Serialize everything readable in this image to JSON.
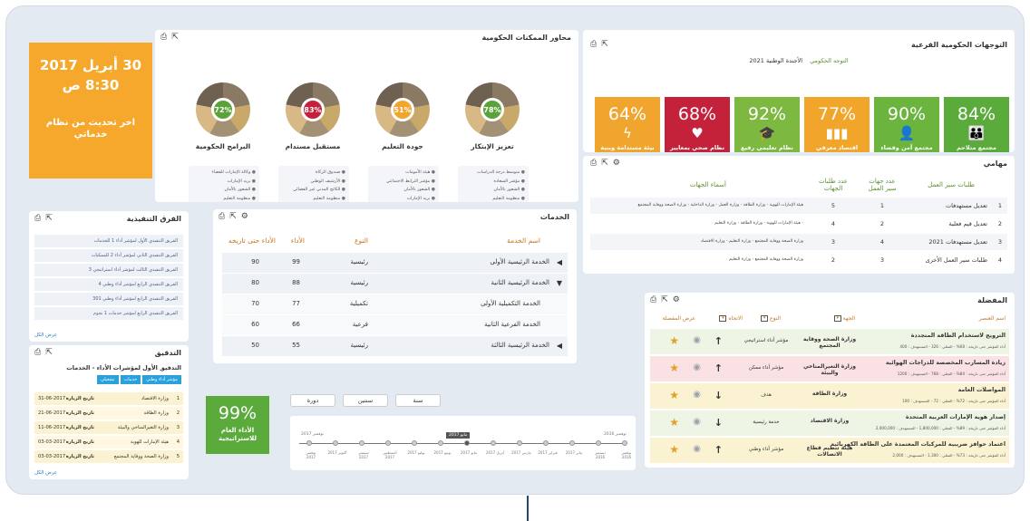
{
  "header_clock": {
    "date": "30 أبريل 2017",
    "time": "8:30 ص",
    "note": "اخر تحديث من نظام خدماتي"
  },
  "sub_directions": {
    "title": "التوجهات الحكومية الفرعية",
    "label": "التوجه الحكومي",
    "agenda": "الأجندة الوطنية 2021",
    "tiles": [
      {
        "pct": "84%",
        "icon": "family-icon",
        "label": "مجتمع متلاحم محافظ على هويته",
        "color": "#5aab3c"
      },
      {
        "pct": "90%",
        "icon": "person-icon",
        "label": "مجتمع آمن وقضاء عادل",
        "color": "#6bb43d"
      },
      {
        "pct": "77%",
        "icon": "bar-chart-icon",
        "label": "اقتصاد معرفي تنافسي",
        "color": "#f2a52b"
      },
      {
        "pct": "92%",
        "icon": "graduation-cap-icon",
        "label": "نظام تعليمي رفيع المستوى",
        "color": "#7db840"
      },
      {
        "pct": "68%",
        "icon": "heartbeat-icon",
        "label": "نظام صحي بمعايير عالمية",
        "color": "#c4213a"
      },
      {
        "pct": "64%",
        "icon": "bolt-icon",
        "label": "بيئة مستدامة وبنية تحتية متكاملة",
        "color": "#f0a62e"
      }
    ]
  },
  "enablers": {
    "title": "محاور الممكنات الحكومية",
    "donuts": [
      {
        "pct": "78%",
        "title": "تعزيز الإبتكار",
        "ring": "#5aa33a",
        "items": [
          "متوسط درجة الدراسات",
          "مؤشر السعادة",
          "الشعور بالأمان",
          "منظومة التعليم",
          "مستقبل أفضل"
        ]
      },
      {
        "pct": "51%",
        "title": "جودة التعليم",
        "ring": "#f2a52b",
        "items": [
          "هيئة الأمومات",
          "مؤشر الترابط الاجتماعي",
          "الشعور بالأمان",
          "بريد الإمارات",
          "مستقبل أفضل"
        ]
      },
      {
        "pct": "83%",
        "title": "مستقبل مستدام",
        "ring": "#c4213a",
        "items": [
          "صندوق الزكاة",
          "الأرشيف الوطني",
          "الكاتج المدني غير الفضائي",
          "منظومة التعليم",
          "مستقبل أفضل"
        ]
      },
      {
        "pct": "72%",
        "title": "البرامج الحكومية",
        "ring": "#5aa33a",
        "items": [
          "وكالة الإمارات للفضاء",
          "بريد الإمارات",
          "الشعور بالأمان",
          "منظومة التعليم",
          "مستقبل أفضل"
        ]
      }
    ]
  },
  "tasks": {
    "title": "مهامي",
    "headers": {
      "req_type": "طلبات سير العمل",
      "count_entities": "عدد جهات سير العمل",
      "count_requests": "عدد طلبات الجهات",
      "names": "أسماء الجهات"
    },
    "rows": [
      {
        "n": "1",
        "type": "تعديل مستهدفات",
        "entities": "1",
        "requests": "5",
        "names": "هيئة الإمارات للهوية - وزارة الطاقة - وزارة العمل - وزارة الداخلية - وزارة الصحة ووقاية المجتمع"
      },
      {
        "n": "2",
        "type": "تعديل قيم فعلية",
        "entities": "2",
        "requests": "4",
        "names": "- هيئة الإمارات للهوية - وزارة الطاقة - وزارة التعليم"
      },
      {
        "n": "3",
        "type": "تعديل مستهدفات 2021",
        "entities": "4",
        "requests": "3",
        "names": "وزارة الصحة ووقاية المجتمع - وزارة التعليم - وزارة الاقتصاد"
      },
      {
        "n": "4",
        "type": "طلبات سير العمل الأخرى",
        "entities": "3",
        "requests": "2",
        "names": "وزارة الصحة ووقاية المجتمع - وزارة التعليم"
      }
    ]
  },
  "teams": {
    "title": "الفرق التنفيذية",
    "items": [
      "الفريق التنفيذي الأول لمؤشر أداء 1 للخدمات",
      "الفريق التنفيذي الثاني لمؤشر أداء 2 للممكنات",
      "الفريق التنفيذي الثالث لمؤشر أداء استراتيجي 3",
      "الفريق التنفيذي الرابع لمؤشر أداء وطني 4",
      "الفريق التنفيذي الرابع لمؤشر أداء وطني 301",
      "الفريق التنفيذي الرابع لمؤشر خدمات 1 نجوم"
    ],
    "show_all": "عرض الكل"
  },
  "services": {
    "title": "الخدمات",
    "headers": {
      "name": "اسم الخدمة",
      "type": "النوع",
      "perf": "الأداء",
      "ytd": "الأداء حتى تاريخه"
    },
    "rows": [
      {
        "name": "الخدمة الرئيسية الأولى",
        "type": "رئيسية",
        "perf": "99",
        "ytd": "90",
        "arrow": "◀",
        "sub": false
      },
      {
        "name": "الخدمة الرئيسية الثانية",
        "type": "رئيسية",
        "perf": "88",
        "ytd": "80",
        "arrow": "▼",
        "sub": false
      },
      {
        "name": "الخدمة التكميلية الأولى",
        "type": "تكميلية",
        "perf": "77",
        "ytd": "70",
        "arrow": "",
        "sub": true
      },
      {
        "name": "الخدمة الفرعية الثانية",
        "type": "فرعية",
        "perf": "66",
        "ytd": "60",
        "arrow": "",
        "sub": true
      },
      {
        "name": "الخدمة الرئيسية الثالثة",
        "type": "رئيسية",
        "perf": "55",
        "ytd": "50",
        "arrow": "◀",
        "sub": false
      }
    ]
  },
  "audit": {
    "title": "التدقيق",
    "subtitle": "التدقيق الأول لمؤشرات الأداء - الخدمات",
    "chips": [
      "مؤشر أداء وطني",
      "خدمات",
      "تشغيلي"
    ],
    "date_label": "تاريخ الزيارة",
    "rows": [
      {
        "n": "1",
        "name": "وزارة الاقتصاد",
        "date": "31-06-2017"
      },
      {
        "n": "2",
        "name": "وزارة الطاقة",
        "date": "21-06-2017"
      },
      {
        "n": "3",
        "name": "وزارة التغيرالمناخي والبيئة",
        "date": "11-06-2017"
      },
      {
        "n": "4",
        "name": "هيئة الإمارات للهوية",
        "date": "03-03-2017"
      },
      {
        "n": "5",
        "name": "وزارة الصحة ووقاية المجتمع",
        "date": "03-03-2017"
      }
    ],
    "show_all": "عرض الكل"
  },
  "strategy": {
    "pct": "99%",
    "label": "الأداء العام للاستراتيجية"
  },
  "timeline": {
    "tabs": [
      "سنة",
      "سنتين",
      "دورة"
    ],
    "current": "مايو 2017",
    "left_marker": "نوفمبر 2017",
    "right_marker": "نوفمبر 2016",
    "months": [
      "نوفمبر 2017",
      "أكتوبر 2017",
      "سبتمبر 2017",
      "أغسطس 2017",
      "يوليو 2017",
      "يونيو 2017",
      "مايو 2017",
      "أبريل 2017",
      "مارس 2017",
      "فبراير 2017",
      "يناير 2017",
      "ديسمبر 2016",
      "نوفمبر 2016"
    ]
  },
  "favorites": {
    "title": "المفضلة",
    "headers": {
      "name": "اسم العنصر",
      "entity": "الجهة",
      "type": "النوع",
      "direction": "الاتجاه",
      "view": "عرض",
      "fav": "المفضلة"
    },
    "rows": [
      {
        "name": "الترويج لاستخدام الطاقة المتجددة",
        "meta": "أداء المؤشر حتى تاريخه : 68% - الفعلي : 326 - المستهدف : 400",
        "entity": "وزارة الصحة ووقاية المجتمع",
        "type": "مؤشر أداء استراتيجي",
        "dir": "↑",
        "bg": "#eef5e4"
      },
      {
        "name": "زيادة المسارب المخصصة للدراجات الهوائية",
        "meta": "أداء المؤشر حتى تاريخه : 84% - الفعلي : 768 - المستهدف : 1200",
        "entity": "وزارة التغيرالمناخي والبيئة",
        "type": "مؤشر أداء ممكن",
        "dir": "↑",
        "bg": "#f9e1e4"
      },
      {
        "name": "المواصلات العامة",
        "meta": "أداء المؤشر حتى تاريخه : 72% - الفعلي : 72 - المستهدف : 100",
        "entity": "وزارة الطاقة",
        "type": "هدف",
        "dir": "↓",
        "bg": "#fbf2d2"
      },
      {
        "name": "إصدار هوية الإمارات العربية المتحدة",
        "meta": "أداء المؤشر حتى تاريخه : 89% - الفعلي : 1,800,000 - المستهدف : 2,000,000",
        "entity": "وزارة الاقتصاد",
        "type": "خدمة رئيسية",
        "dir": "↓",
        "bg": "#eef5e4"
      },
      {
        "name": "اعتماد حوافز ضريبية للمركبات المعتمدة على الطاقة الكهربائية",
        "meta": "أداء المؤشر حتى تاريخه : 73% - الفعلي : 1,300 - المستهدف : 2,000",
        "entity": "هيئة تنظيم قطاع الاتصالات",
        "type": "مؤشر أداء وطني",
        "dir": "↑",
        "bg": "#fbf2d2"
      }
    ]
  }
}
